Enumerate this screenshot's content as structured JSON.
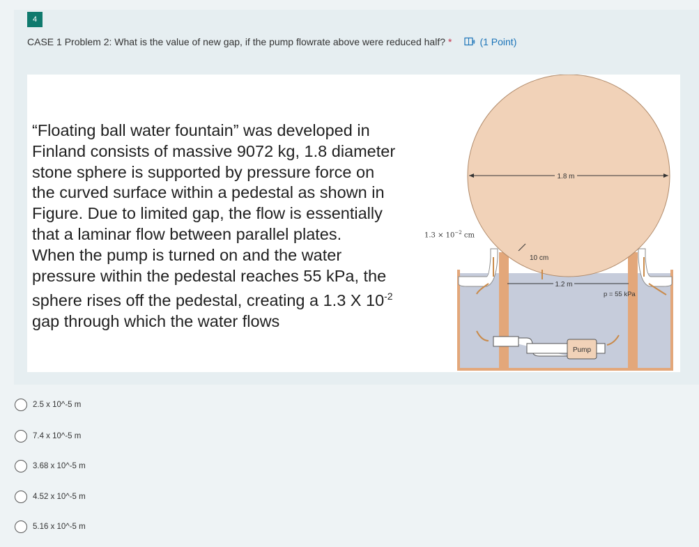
{
  "question": {
    "number": "4",
    "text": "CASE 1 Problem 2: What is the value of new gap, if the pump flowrate above were reduced half?",
    "required_mark": "*",
    "points": "(1 Point)"
  },
  "figure": {
    "description_lines": [
      "“Floating ball water fountain” was developed in",
      "Finland consists of massive 9072 kg, 1.8 diameter",
      "stone sphere is supported by pressure force on",
      "the curved surface within a pedestal as shown in",
      "Figure. Due to limited gap, the flow is essentially",
      "that a laminar flow between parallel plates.",
      "When the pump is turned on and the water",
      "pressure within the pedestal reaches 55 kPa, the",
      "sphere rises off the pedestal, creating a 1.3 X 10",
      "gap through which the water flows"
    ],
    "description_sup": "-2",
    "gap_label": "1.3 × 10",
    "gap_label_sup": "−2",
    "gap_label_unit": " cm",
    "diameter_label": "1.8 m",
    "pedestal_height_label": "10 cm",
    "pedestal_width_label": "1.2 m",
    "pressure_label": "p = 55 kPa",
    "pump_label": "Pump",
    "colors": {
      "sphere": "#f1d2b8",
      "water": "#c6ccdb",
      "pedestal": "#e3a77a",
      "accent": "#0f7a6e"
    }
  },
  "options": [
    {
      "label": "2.5 x 10^-5 m"
    },
    {
      "label": "7.4 x 10^-5 m"
    },
    {
      "label": "3.68 x 10^-5 m"
    },
    {
      "label": "4.52 x 10^-5 m"
    },
    {
      "label": "5.16 x 10^-5 m"
    }
  ]
}
